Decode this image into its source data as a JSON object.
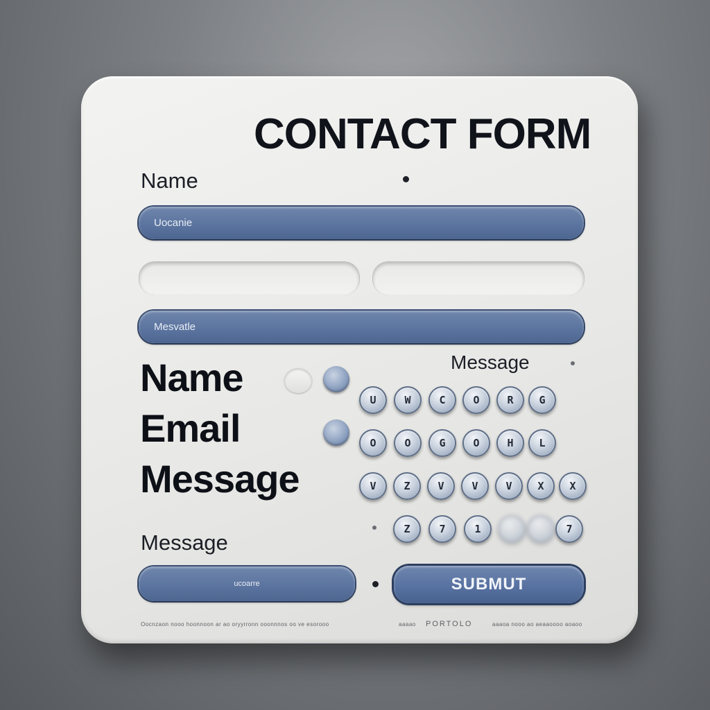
{
  "form": {
    "title": "CONTACT FORM",
    "name_label": "Name",
    "name_field_text": "Uocanie",
    "message_field_text": "Mesvatle",
    "label_name_big": "Name",
    "label_email_big": "Email",
    "label_message_big": "Message",
    "label_message_right": "Message",
    "label_message_bottom": "Message",
    "bottom_field_text": "ucoarre",
    "submit_label": "SUBMUT",
    "footer_left": "Oocnzaon nooo hoonnoon ar ao oryyrronn ooonnnos oo ve esorooo",
    "footer_mid_small": "aaaao",
    "footer_mid": "PORTOLO",
    "footer_right": "aaaoa nooo ao aeaaoooo aoaoo"
  },
  "keypad": {
    "rows": [
      [
        "U",
        "W",
        "C",
        "O",
        "R",
        "G"
      ],
      [
        "O",
        "O",
        "G",
        "O",
        "H",
        "L"
      ],
      [
        "V",
        "Z",
        "V",
        "V",
        "V",
        "X",
        "X"
      ],
      [
        "Z",
        "7",
        "1",
        "",
        "",
        "7"
      ]
    ]
  },
  "colors": {
    "accent": "#5c75a0",
    "card": "#ececea",
    "text": "#10131a",
    "background": "#6f7276"
  }
}
